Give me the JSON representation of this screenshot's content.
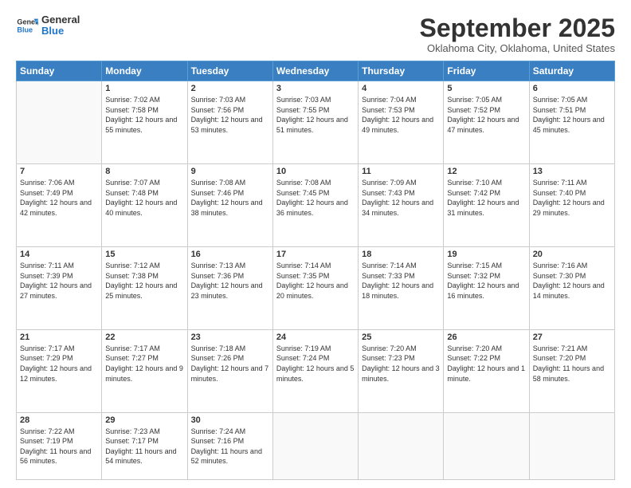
{
  "logo": {
    "general": "General",
    "blue": "Blue"
  },
  "header": {
    "month_title": "September 2025",
    "location": "Oklahoma City, Oklahoma, United States"
  },
  "days_of_week": [
    "Sunday",
    "Monday",
    "Tuesday",
    "Wednesday",
    "Thursday",
    "Friday",
    "Saturday"
  ],
  "weeks": [
    [
      {
        "day": "",
        "sunrise": "",
        "sunset": "",
        "daylight": ""
      },
      {
        "day": "1",
        "sunrise": "Sunrise: 7:02 AM",
        "sunset": "Sunset: 7:58 PM",
        "daylight": "Daylight: 12 hours and 55 minutes."
      },
      {
        "day": "2",
        "sunrise": "Sunrise: 7:03 AM",
        "sunset": "Sunset: 7:56 PM",
        "daylight": "Daylight: 12 hours and 53 minutes."
      },
      {
        "day": "3",
        "sunrise": "Sunrise: 7:03 AM",
        "sunset": "Sunset: 7:55 PM",
        "daylight": "Daylight: 12 hours and 51 minutes."
      },
      {
        "day": "4",
        "sunrise": "Sunrise: 7:04 AM",
        "sunset": "Sunset: 7:53 PM",
        "daylight": "Daylight: 12 hours and 49 minutes."
      },
      {
        "day": "5",
        "sunrise": "Sunrise: 7:05 AM",
        "sunset": "Sunset: 7:52 PM",
        "daylight": "Daylight: 12 hours and 47 minutes."
      },
      {
        "day": "6",
        "sunrise": "Sunrise: 7:05 AM",
        "sunset": "Sunset: 7:51 PM",
        "daylight": "Daylight: 12 hours and 45 minutes."
      }
    ],
    [
      {
        "day": "7",
        "sunrise": "Sunrise: 7:06 AM",
        "sunset": "Sunset: 7:49 PM",
        "daylight": "Daylight: 12 hours and 42 minutes."
      },
      {
        "day": "8",
        "sunrise": "Sunrise: 7:07 AM",
        "sunset": "Sunset: 7:48 PM",
        "daylight": "Daylight: 12 hours and 40 minutes."
      },
      {
        "day": "9",
        "sunrise": "Sunrise: 7:08 AM",
        "sunset": "Sunset: 7:46 PM",
        "daylight": "Daylight: 12 hours and 38 minutes."
      },
      {
        "day": "10",
        "sunrise": "Sunrise: 7:08 AM",
        "sunset": "Sunset: 7:45 PM",
        "daylight": "Daylight: 12 hours and 36 minutes."
      },
      {
        "day": "11",
        "sunrise": "Sunrise: 7:09 AM",
        "sunset": "Sunset: 7:43 PM",
        "daylight": "Daylight: 12 hours and 34 minutes."
      },
      {
        "day": "12",
        "sunrise": "Sunrise: 7:10 AM",
        "sunset": "Sunset: 7:42 PM",
        "daylight": "Daylight: 12 hours and 31 minutes."
      },
      {
        "day": "13",
        "sunrise": "Sunrise: 7:11 AM",
        "sunset": "Sunset: 7:40 PM",
        "daylight": "Daylight: 12 hours and 29 minutes."
      }
    ],
    [
      {
        "day": "14",
        "sunrise": "Sunrise: 7:11 AM",
        "sunset": "Sunset: 7:39 PM",
        "daylight": "Daylight: 12 hours and 27 minutes."
      },
      {
        "day": "15",
        "sunrise": "Sunrise: 7:12 AM",
        "sunset": "Sunset: 7:38 PM",
        "daylight": "Daylight: 12 hours and 25 minutes."
      },
      {
        "day": "16",
        "sunrise": "Sunrise: 7:13 AM",
        "sunset": "Sunset: 7:36 PM",
        "daylight": "Daylight: 12 hours and 23 minutes."
      },
      {
        "day": "17",
        "sunrise": "Sunrise: 7:14 AM",
        "sunset": "Sunset: 7:35 PM",
        "daylight": "Daylight: 12 hours and 20 minutes."
      },
      {
        "day": "18",
        "sunrise": "Sunrise: 7:14 AM",
        "sunset": "Sunset: 7:33 PM",
        "daylight": "Daylight: 12 hours and 18 minutes."
      },
      {
        "day": "19",
        "sunrise": "Sunrise: 7:15 AM",
        "sunset": "Sunset: 7:32 PM",
        "daylight": "Daylight: 12 hours and 16 minutes."
      },
      {
        "day": "20",
        "sunrise": "Sunrise: 7:16 AM",
        "sunset": "Sunset: 7:30 PM",
        "daylight": "Daylight: 12 hours and 14 minutes."
      }
    ],
    [
      {
        "day": "21",
        "sunrise": "Sunrise: 7:17 AM",
        "sunset": "Sunset: 7:29 PM",
        "daylight": "Daylight: 12 hours and 12 minutes."
      },
      {
        "day": "22",
        "sunrise": "Sunrise: 7:17 AM",
        "sunset": "Sunset: 7:27 PM",
        "daylight": "Daylight: 12 hours and 9 minutes."
      },
      {
        "day": "23",
        "sunrise": "Sunrise: 7:18 AM",
        "sunset": "Sunset: 7:26 PM",
        "daylight": "Daylight: 12 hours and 7 minutes."
      },
      {
        "day": "24",
        "sunrise": "Sunrise: 7:19 AM",
        "sunset": "Sunset: 7:24 PM",
        "daylight": "Daylight: 12 hours and 5 minutes."
      },
      {
        "day": "25",
        "sunrise": "Sunrise: 7:20 AM",
        "sunset": "Sunset: 7:23 PM",
        "daylight": "Daylight: 12 hours and 3 minutes."
      },
      {
        "day": "26",
        "sunrise": "Sunrise: 7:20 AM",
        "sunset": "Sunset: 7:22 PM",
        "daylight": "Daylight: 12 hours and 1 minute."
      },
      {
        "day": "27",
        "sunrise": "Sunrise: 7:21 AM",
        "sunset": "Sunset: 7:20 PM",
        "daylight": "Daylight: 11 hours and 58 minutes."
      }
    ],
    [
      {
        "day": "28",
        "sunrise": "Sunrise: 7:22 AM",
        "sunset": "Sunset: 7:19 PM",
        "daylight": "Daylight: 11 hours and 56 minutes."
      },
      {
        "day": "29",
        "sunrise": "Sunrise: 7:23 AM",
        "sunset": "Sunset: 7:17 PM",
        "daylight": "Daylight: 11 hours and 54 minutes."
      },
      {
        "day": "30",
        "sunrise": "Sunrise: 7:24 AM",
        "sunset": "Sunset: 7:16 PM",
        "daylight": "Daylight: 11 hours and 52 minutes."
      },
      {
        "day": "",
        "sunrise": "",
        "sunset": "",
        "daylight": ""
      },
      {
        "day": "",
        "sunrise": "",
        "sunset": "",
        "daylight": ""
      },
      {
        "day": "",
        "sunrise": "",
        "sunset": "",
        "daylight": ""
      },
      {
        "day": "",
        "sunrise": "",
        "sunset": "",
        "daylight": ""
      }
    ]
  ]
}
